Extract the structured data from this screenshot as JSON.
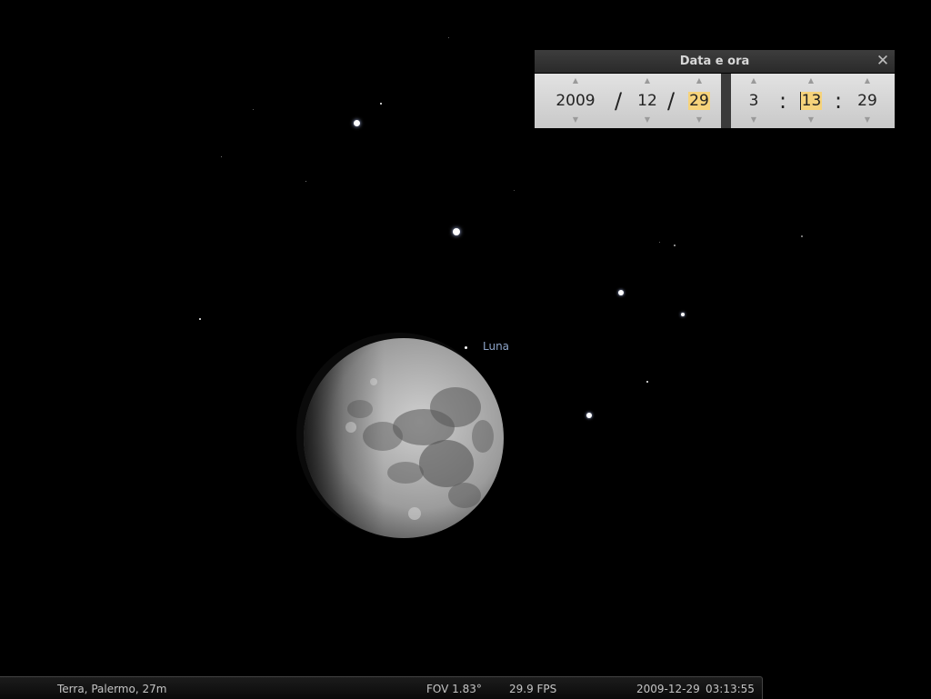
{
  "sky": {
    "moon_label": "Luna"
  },
  "date_time_dialog": {
    "title": "Data e ora",
    "year": "2009",
    "month": "12",
    "day": "29",
    "hour": "3",
    "minute": "13",
    "second": "29",
    "date_separator": "/",
    "time_separator": ":",
    "close_icon": "close-icon",
    "highlight_color": "#f6d37b"
  },
  "status_bar": {
    "location": "Terra, Palermo, 27m",
    "fov": "FOV 1.83°",
    "fps": "29.9 FPS",
    "date": "2009-12-29",
    "time": "03:13:55"
  }
}
